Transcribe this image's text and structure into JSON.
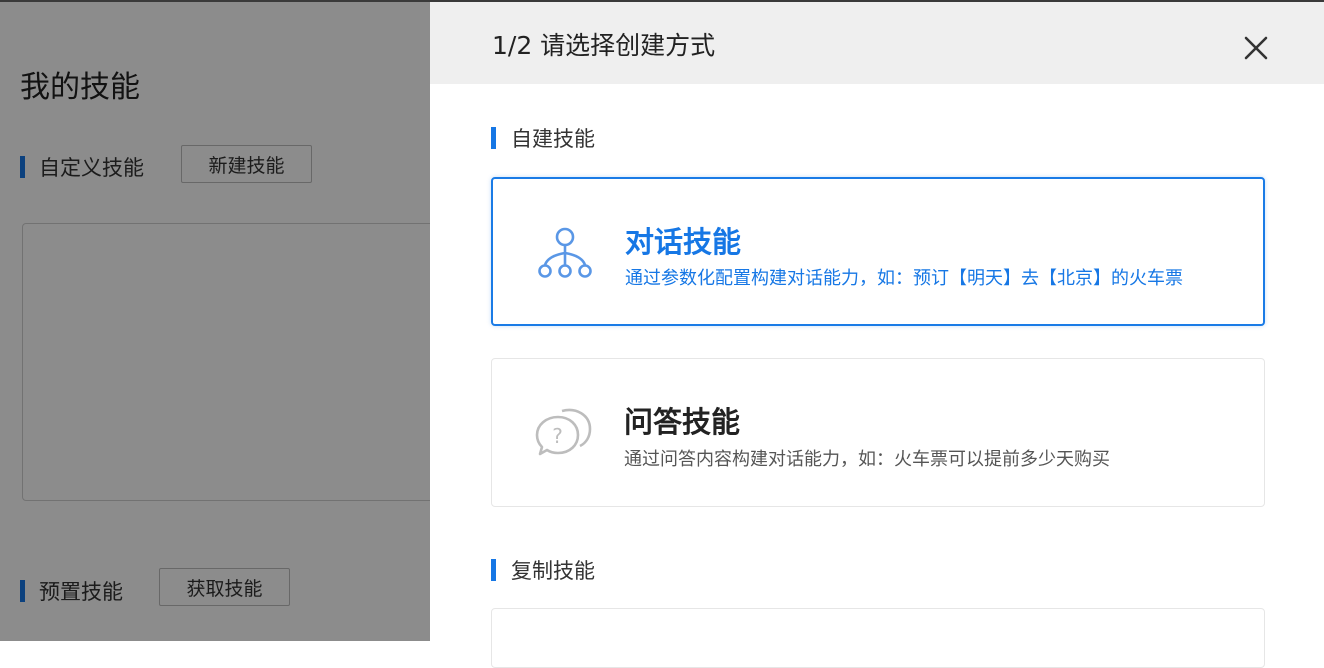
{
  "background": {
    "page_title": "我的技能",
    "custom_section": {
      "label": "自定义技能",
      "button": "新建技能"
    },
    "preset_section": {
      "label": "预置技能",
      "button": "获取技能"
    }
  },
  "drawer": {
    "title": "1/2 请选择创建方式",
    "close_icon": "close-icon",
    "sections": [
      {
        "label": "自建技能",
        "cards": [
          {
            "title": "对话技能",
            "desc": "通过参数化配置构建对话能力，如：预订【明天】去【北京】的火车票",
            "icon": "tree-nodes-icon",
            "selected": true
          },
          {
            "title": "问答技能",
            "desc": "通过问答内容构建对话能力，如：火车票可以提前多少天购买",
            "icon": "question-chat-icon",
            "selected": false
          }
        ]
      },
      {
        "label": "复制技能"
      }
    ]
  },
  "colors": {
    "accent": "#1677e5",
    "overlay": "#000000",
    "header_bg": "#efefef",
    "inactive_icon": "#bdbdbd"
  }
}
